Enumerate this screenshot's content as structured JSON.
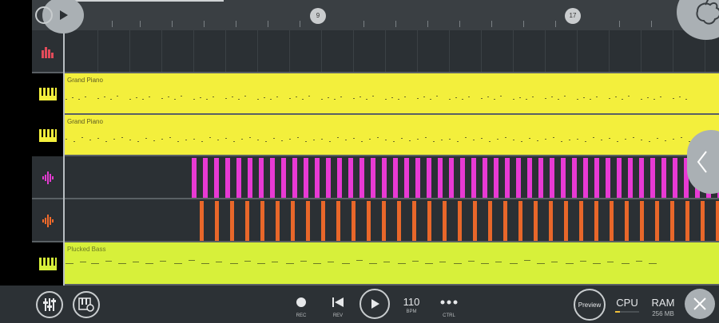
{
  "ruler": {
    "markers": [
      "9",
      "17"
    ]
  },
  "tracks": [
    {
      "icon": "bar-chart-icon",
      "type": "automation",
      "label": ""
    },
    {
      "icon": "piano-keys-icon",
      "type": "pattern",
      "label": "Grand Piano",
      "color": "#f3ef3c"
    },
    {
      "icon": "piano-keys-icon",
      "type": "pattern",
      "label": "Grand Piano",
      "color": "#f3ef3c"
    },
    {
      "icon": "waveform-icon",
      "type": "audio",
      "label": "",
      "color": "#f23bdc"
    },
    {
      "icon": "waveform-icon",
      "type": "audio",
      "label": "",
      "color": "#f26a2a"
    },
    {
      "icon": "piano-keys-icon",
      "type": "pattern",
      "label": "Plucked Bass",
      "color": "#d7f03a"
    }
  ],
  "transport": {
    "rec_label": "REC",
    "rev_label": "REV",
    "bpm_value": "110",
    "bpm_label": "BPM",
    "ctrl_label": "CTRL",
    "preview_label": "Preview",
    "cpu_label": "CPU",
    "ram_label": "RAM",
    "ram_value": "256 MB"
  },
  "colors": {
    "accent_yellow": "#f3ef3c",
    "accent_lime": "#d7f03a",
    "accent_magenta": "#f23bdc",
    "accent_orange": "#f26a2a"
  }
}
